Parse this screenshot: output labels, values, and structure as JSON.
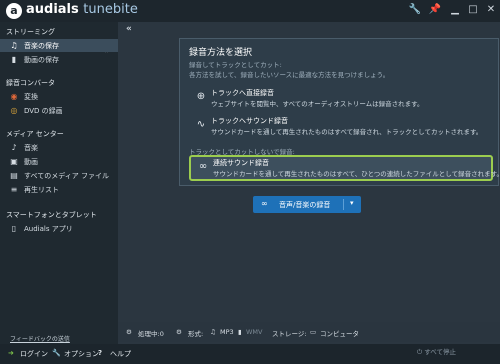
{
  "app": {
    "brand_part1": "audials",
    "brand_part2": "tunebite"
  },
  "titlebar_icons": [
    "wrench-icon",
    "pin-icon",
    "minimize-icon",
    "maximize-icon",
    "close-icon"
  ],
  "sidebar": {
    "sections": [
      {
        "title": "ストリーミング",
        "items": [
          {
            "label": "音楽の保存",
            "icon": "music-note-icon",
            "selected": true
          },
          {
            "label": "動画の保存",
            "icon": "video-icon"
          }
        ]
      },
      {
        "title": "録音コンバータ",
        "items": [
          {
            "label": "変換",
            "icon": "convert-icon"
          },
          {
            "label": "DVD の録画",
            "icon": "dvd-icon"
          }
        ]
      },
      {
        "title": "メディア センター",
        "items": [
          {
            "label": "音楽",
            "icon": "music-icon"
          },
          {
            "label": "動画",
            "icon": "movie-icon"
          },
          {
            "label": "すべてのメディア ファイル",
            "icon": "files-icon"
          },
          {
            "label": "再生リスト",
            "icon": "playlist-icon"
          }
        ]
      },
      {
        "title": "スマートフォンとタブレット",
        "items": [
          {
            "label": "Audials アプリ",
            "icon": "phone-icon"
          }
        ]
      }
    ],
    "feedback": "フィードバックの送信"
  },
  "popup": {
    "title": "録音方法を選択",
    "subtitle": "録音してトラックとしてカット:",
    "description": "各方法を試して、録音したいソースに最適な方法を見つけましょう。",
    "options": [
      {
        "title": "トラックへ直接録音",
        "desc": "ウェブサイトを閲覧中、すべてのオーディオストリームは録音されます。",
        "icon": "globe-icon"
      },
      {
        "title": "トラックへサウンド録音",
        "desc": "サウンドカードを通して再生されたものはすべて録音され、トラックとしてカットされます。",
        "icon": "waveform-icon"
      }
    ],
    "separator": "トラックとしてカットしないで録音:",
    "highlighted_option": {
      "title": "連続サウンド録音",
      "desc": "サウンドカードを通して再生されたものはすべて、ひとつの連続したファイルとして録音されます。",
      "icon": "infinity-icon"
    }
  },
  "record_button": {
    "label": "音声/音楽の録音"
  },
  "statusbar": {
    "processing": "処理中:0",
    "format_label": "形式:",
    "format_mp3": "MP3",
    "format_wmv": "WMV",
    "storage_label": "ストレージ:",
    "storage_value": "コンピュータ"
  },
  "bottombar": {
    "login": "ログイン",
    "options": "オプション",
    "help": "ヘルプ",
    "stop_all": "すべて停止"
  },
  "colors": {
    "accent": "#1e71b8",
    "highlight_border": "#9ccd4f",
    "sidebar_bg": "#1f2930"
  }
}
